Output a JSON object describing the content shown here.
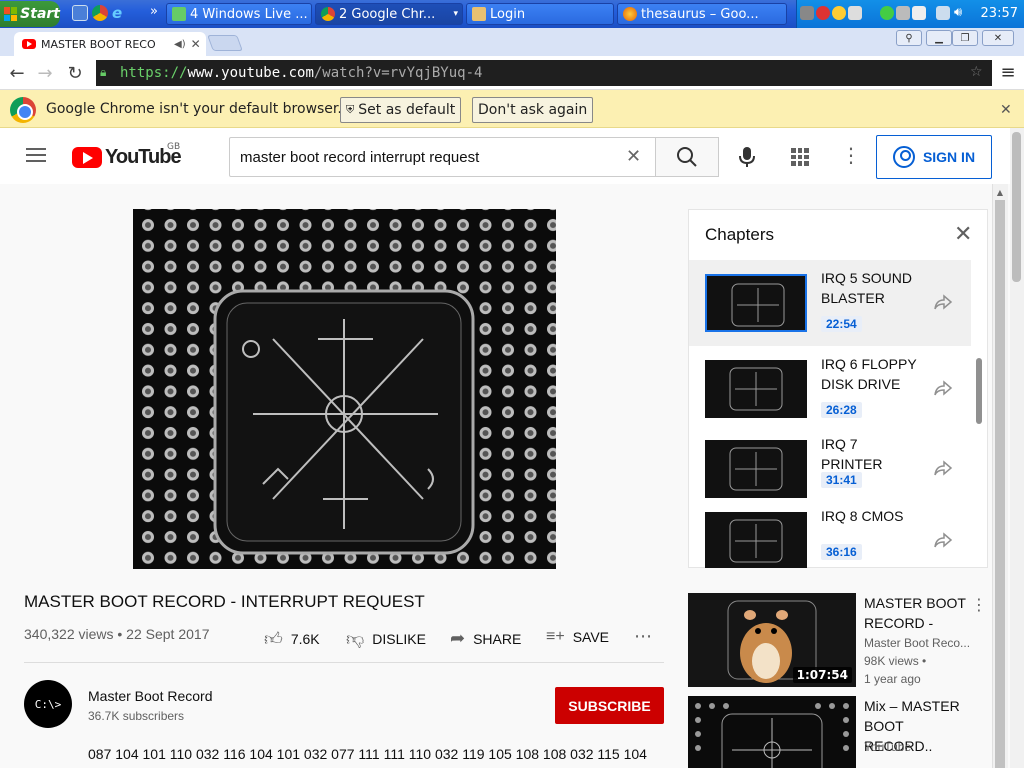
{
  "taskbar": {
    "start_label": "Start",
    "tasks": [
      {
        "label": "4 Windows Live ...",
        "icon": "messenger-icon"
      },
      {
        "label": "2 Google Chr...",
        "icon": "chrome-icon",
        "active": true
      },
      {
        "label": "Login",
        "icon": "page-icon"
      },
      {
        "label": "thesaurus – Goo...",
        "icon": "firefox-icon"
      }
    ],
    "clock": "23:57"
  },
  "browser": {
    "tab_title": "MASTER BOOT RECO",
    "url_scheme": "https://",
    "url_host": "www.youtube.com",
    "url_path": "/watch?v=rvYqjBYuq-4",
    "infobar_text": "Google Chrome isn't your default browser.",
    "set_default_label": "Set as default",
    "dont_ask_label": "Don't ask again"
  },
  "youtube": {
    "logo_text": "YouTube",
    "region": "GB",
    "search_value": "master boot record interrupt request",
    "signin_label": "SIGN IN"
  },
  "video": {
    "title": "MASTER BOOT RECORD - INTERRUPT REQUEST",
    "meta": "340,322 views • 22 Sept 2017",
    "likes": "7.6K",
    "dislike_label": "DISLIKE",
    "share_label": "SHARE",
    "save_label": "SAVE",
    "channel_avatar_text": "C:\\>",
    "channel_name": "Master Boot Record",
    "subscribers": "36.7K subscribers",
    "subscribe_label": "SUBSCRIBE",
    "description_line": "087 104 101 110 032 116 104 101 032 077 111 111 110 032 119 105 108 108 032 115 104"
  },
  "chapters": {
    "heading": "Chapters",
    "items": [
      {
        "title": "IRQ 5 SOUND BLASTER",
        "time": "22:54",
        "selected": true
      },
      {
        "title": "IRQ 6 FLOPPY DISK DRIVE",
        "time": "26:28"
      },
      {
        "title": "IRQ 7 PRINTER",
        "time": "31:41"
      },
      {
        "title": "IRQ 8 CMOS",
        "time": "36:16"
      }
    ]
  },
  "recommendations": [
    {
      "title": "MASTER BOOT RECORD -",
      "channel": "Master Boot Reco...",
      "views": "98K views •",
      "age": "1 year ago",
      "duration": "1:07:54"
    },
    {
      "title": "Mix – MASTER BOOT RECORD..",
      "channel": "YouTube"
    }
  ],
  "colors": {
    "youtube_red": "#ff0000",
    "subscribe_red": "#cc0000",
    "link_blue": "#065fd4",
    "infobar_yellow": "#fcf0b2"
  }
}
